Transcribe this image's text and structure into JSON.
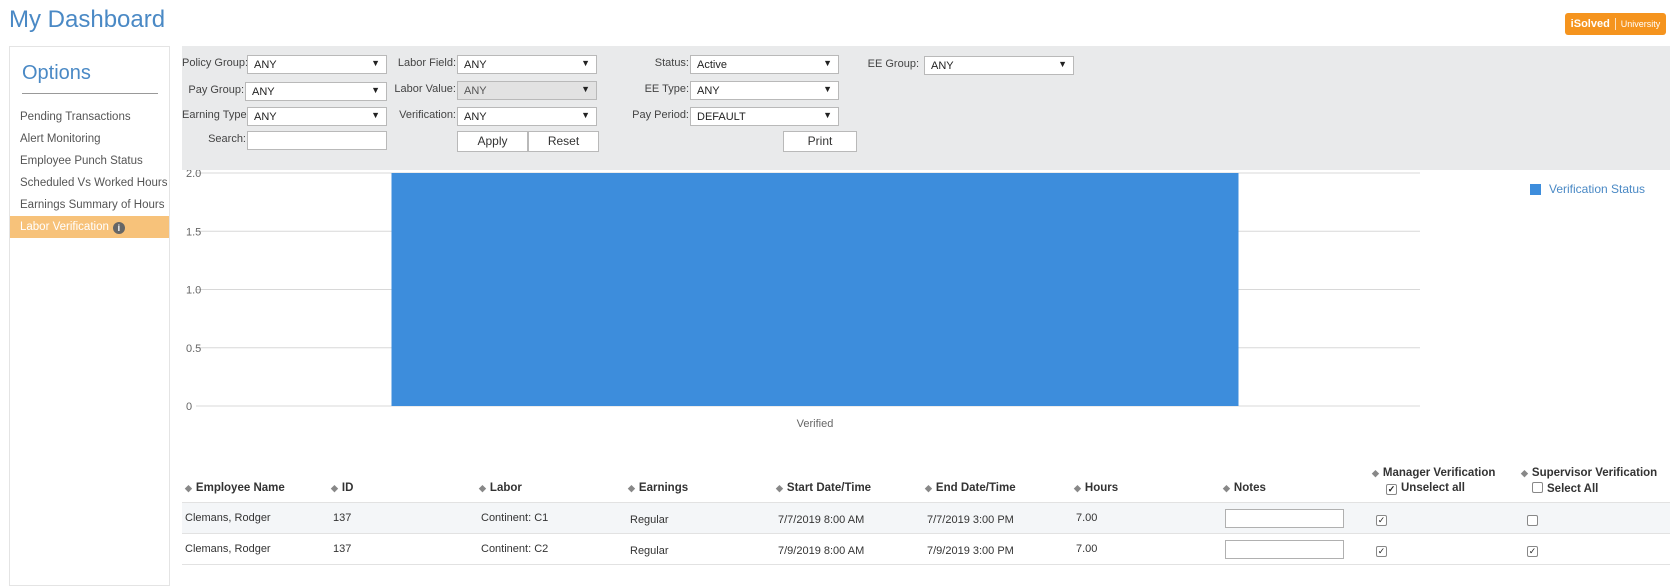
{
  "header": {
    "title": "My Dashboard",
    "brand_main": "iSolved",
    "brand_sub": "University",
    "brand_color": "#f5941e"
  },
  "sidebar": {
    "title": "Options",
    "items": [
      {
        "label": "Pending Transactions"
      },
      {
        "label": "Alert Monitoring"
      },
      {
        "label": "Employee Punch Status"
      },
      {
        "label": "Scheduled Vs Worked Hours"
      },
      {
        "label": "Earnings Summary of Hours"
      },
      {
        "label": "Labor Verification",
        "active": true
      }
    ]
  },
  "filters": {
    "policy_group": {
      "label": "Policy Group:",
      "value": "ANY"
    },
    "pay_group": {
      "label": "Pay Group:",
      "value": "ANY"
    },
    "earning_type": {
      "label": "Earning Type:",
      "value": "ANY"
    },
    "search": {
      "label": "Search:",
      "value": ""
    },
    "labor_field": {
      "label": "Labor Field:",
      "value": "ANY"
    },
    "labor_value": {
      "label": "Labor Value:",
      "value": "ANY"
    },
    "verification": {
      "label": "Verification:",
      "value": "ANY"
    },
    "status": {
      "label": "Status:",
      "value": "Active"
    },
    "ee_type": {
      "label": "EE Type:",
      "value": "ANY"
    },
    "pay_period": {
      "label": "Pay Period:",
      "value": "DEFAULT"
    },
    "ee_group": {
      "label": "EE Group:",
      "value": "ANY"
    },
    "apply_label": "Apply",
    "reset_label": "Reset",
    "print_label": "Print"
  },
  "chart_data": {
    "type": "bar",
    "categories": [
      "Verified"
    ],
    "series": [
      {
        "name": "Verification Status",
        "values": [
          2.0
        ],
        "color": "#3d8ddc"
      }
    ],
    "yticks": [
      "0",
      "0.5",
      "1.0",
      "1.5",
      "2.0"
    ],
    "ylim": [
      0,
      2
    ],
    "legend_position": "top-right",
    "grid": true
  },
  "table": {
    "columns": [
      "Employee Name",
      "ID",
      "Labor",
      "Earnings",
      "Start Date/Time",
      "End Date/Time",
      "Hours",
      "Notes",
      "Manager Verification",
      "Supervisor Verification"
    ],
    "manager_toggle": "Unselect all",
    "supervisor_toggle": "Select All",
    "rows": [
      {
        "name": "Clemans, Rodger",
        "id": "137",
        "labor": "Continent: C1",
        "earnings": "Regular",
        "start": "7/7/2019 8:00 AM",
        "end": "7/7/2019 3:00 PM",
        "hours": "7.00",
        "notes": "",
        "manager": true,
        "supervisor": false
      },
      {
        "name": "Clemans, Rodger",
        "id": "137",
        "labor": "Continent: C2",
        "earnings": "Regular",
        "start": "7/9/2019 8:00 AM",
        "end": "7/9/2019 3:00 PM",
        "hours": "7.00",
        "notes": "",
        "manager": true,
        "supervisor": true
      }
    ]
  }
}
